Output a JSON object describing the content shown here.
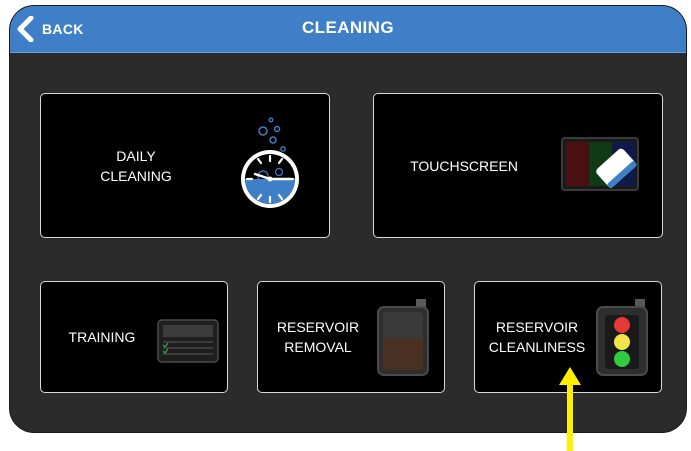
{
  "header": {
    "title": "CLEANING",
    "back_label": "BACK",
    "bg_color": "#3f7fc8"
  },
  "tiles": [
    {
      "label": "DAILY\nCLEANING",
      "icon": "clock-bubbles-icon"
    },
    {
      "label": "TOUCHSCREEN",
      "icon": "screen-eraser-icon"
    },
    {
      "label": "TRAINING",
      "icon": "training-panel-icon"
    },
    {
      "label": "RESERVOIR\nREMOVAL",
      "icon": "reservoir-icon"
    },
    {
      "label": "RESERVOIR\nCLEANLINESS",
      "icon": "traffic-light-icon"
    }
  ],
  "annotation": {
    "arrow_color": "#ffee00",
    "icon": "up-arrow-icon"
  }
}
